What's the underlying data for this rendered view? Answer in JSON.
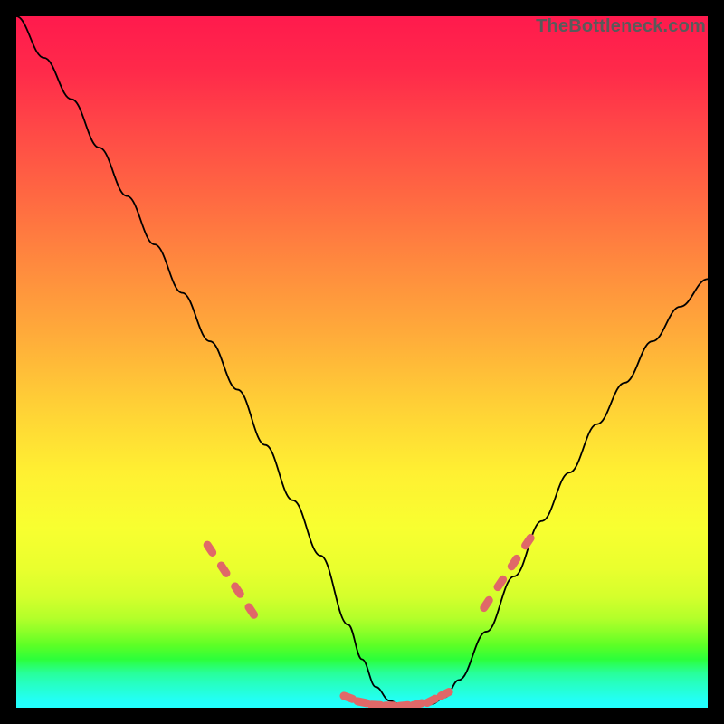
{
  "watermark": "TheBottleneck.com",
  "chart_data": {
    "type": "line",
    "title": "",
    "xlabel": "",
    "ylabel": "",
    "xlim": [
      0,
      100
    ],
    "ylim": [
      0,
      100
    ],
    "grid": false,
    "series": [
      {
        "name": "main-curve",
        "color": "#000000",
        "x": [
          0,
          4,
          8,
          12,
          16,
          20,
          24,
          28,
          32,
          36,
          40,
          44,
          48,
          50,
          52,
          54,
          56,
          58,
          60,
          62,
          64,
          68,
          72,
          76,
          80,
          84,
          88,
          92,
          96,
          100
        ],
        "y": [
          100,
          94,
          88,
          81,
          74,
          67,
          60,
          53,
          46,
          38,
          30,
          22,
          12,
          7,
          3,
          1,
          0.3,
          0.3,
          0.5,
          1.5,
          4,
          11,
          19,
          27,
          34,
          41,
          47,
          53,
          58,
          62
        ]
      },
      {
        "name": "left-accent-zone",
        "color": "#e06868",
        "style": "dotted",
        "x": [
          28,
          30,
          32,
          34
        ],
        "y": [
          23,
          20,
          17,
          14
        ]
      },
      {
        "name": "bottom-accent-zone",
        "color": "#e06868",
        "style": "dotted",
        "x": [
          48,
          50,
          52,
          54,
          56,
          58,
          60,
          62
        ],
        "y": [
          1.5,
          0.8,
          0.4,
          0.3,
          0.3,
          0.5,
          1.0,
          2.0
        ]
      },
      {
        "name": "right-accent-zone",
        "color": "#e06868",
        "style": "dotted",
        "x": [
          68,
          70,
          72,
          74
        ],
        "y": [
          15,
          18,
          21,
          24
        ]
      }
    ]
  }
}
